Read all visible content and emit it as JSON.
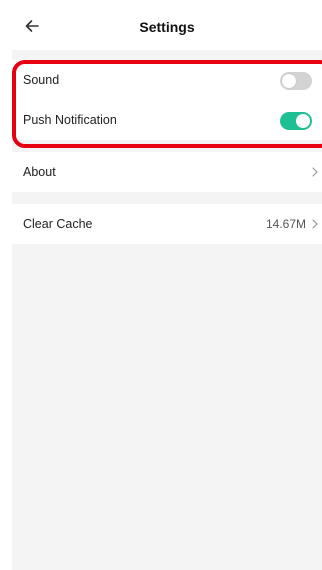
{
  "header": {
    "title": "Settings",
    "back_icon": "arrow-left-icon"
  },
  "settings": {
    "sound": {
      "label": "Sound",
      "enabled": false
    },
    "push_notification": {
      "label": "Push Notification",
      "enabled": true
    },
    "about": {
      "label": "About"
    },
    "clear_cache": {
      "label": "Clear Cache",
      "value": "14.67M"
    }
  },
  "colors": {
    "toggle_on": "#1fbf94",
    "toggle_off": "#d3d3d3",
    "highlight": "#e60012",
    "background": "#f4f4f4"
  }
}
